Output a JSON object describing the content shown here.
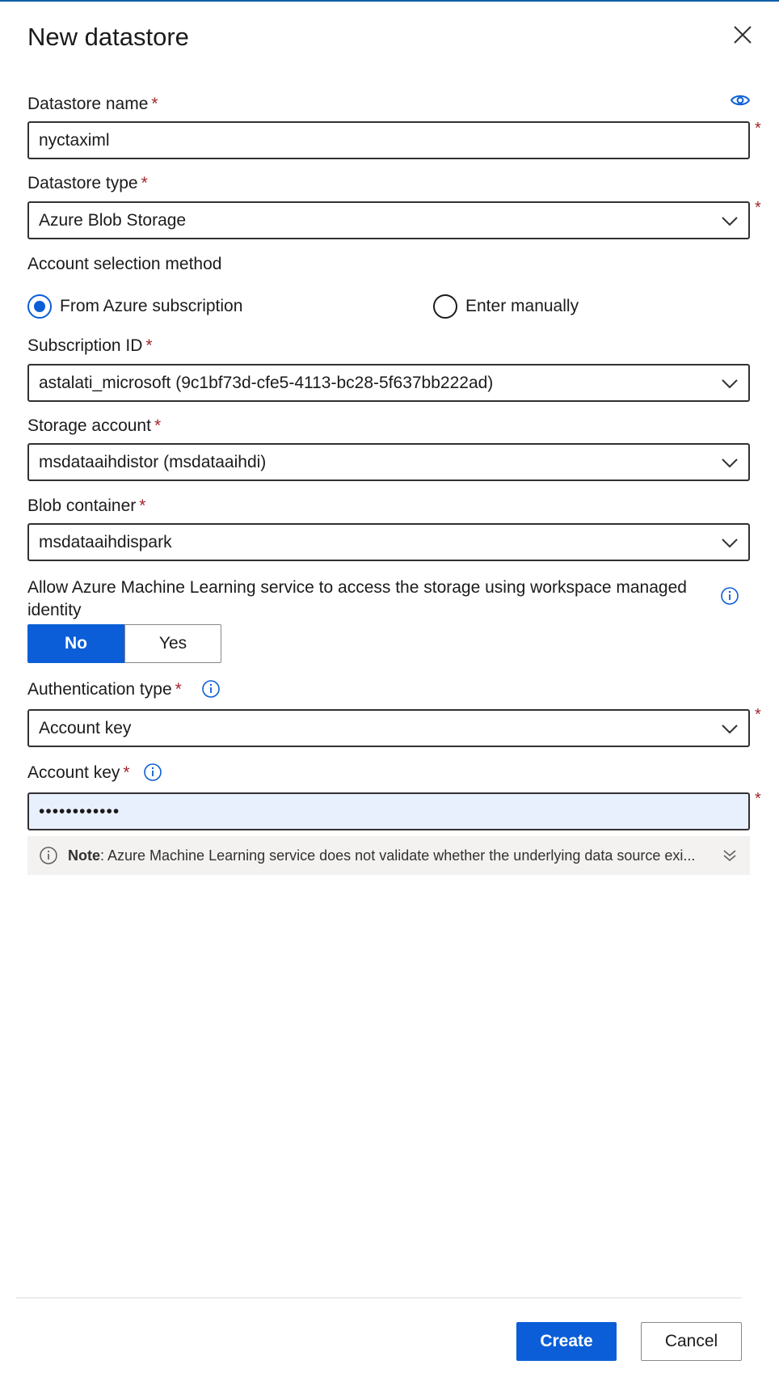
{
  "panel": {
    "title": "New datastore",
    "close_icon": "close-icon"
  },
  "form": {
    "datastore_name": {
      "label": "Datastore name",
      "required_mark": "*",
      "value": "nyctaximl",
      "eye_icon": "eye-icon"
    },
    "datastore_type": {
      "label": "Datastore type",
      "required_mark": "*",
      "value": "Azure Blob Storage"
    },
    "account_selection": {
      "label": "Account selection method",
      "options": [
        {
          "label": "From Azure subscription",
          "selected": true
        },
        {
          "label": "Enter manually",
          "selected": false
        }
      ]
    },
    "subscription_id": {
      "label": "Subscription ID",
      "required_mark": "*",
      "value": "astalati_microsoft (9c1bf73d-cfe5-4113-bc28-5f637bb222ad)"
    },
    "storage_account": {
      "label": "Storage account",
      "required_mark": "*",
      "value": "msdataaihdistor (msdataaihdi)"
    },
    "blob_container": {
      "label": "Blob container",
      "required_mark": "*",
      "value": "msdataaihdispark"
    },
    "managed_identity": {
      "label": "Allow Azure Machine Learning service to access the storage using workspace managed identity",
      "options": [
        "No",
        "Yes"
      ],
      "selected": "No"
    },
    "authentication_type": {
      "label": "Authentication type",
      "required_mark": "*",
      "value": "Account key"
    },
    "account_key": {
      "label": "Account key",
      "required_mark": "*",
      "value": "••••••••••••"
    }
  },
  "note": {
    "bold": "Note",
    "text": ": Azure Machine Learning service does not validate whether the underlying data source exi..."
  },
  "footer": {
    "create_label": "Create",
    "cancel_label": "Cancel"
  },
  "colors": {
    "accent": "#0b5ed7",
    "required": "#a4262c",
    "focused_field_bg": "#e8f0fe"
  }
}
